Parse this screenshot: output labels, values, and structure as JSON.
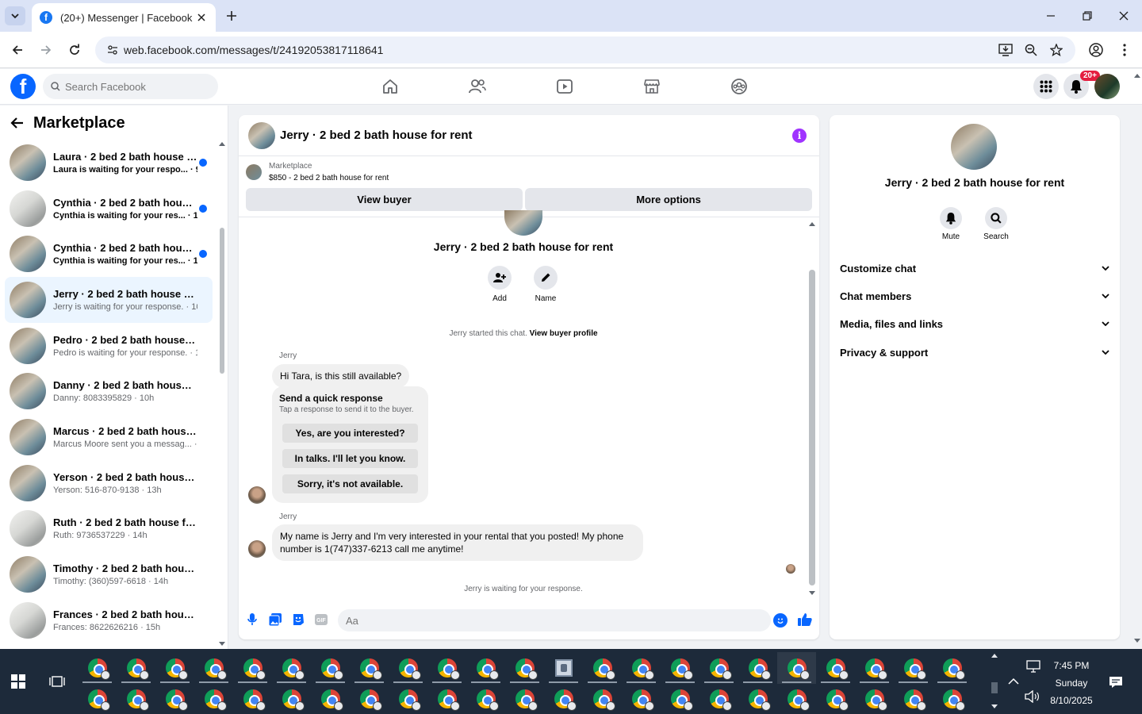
{
  "browser": {
    "tab_title": "(20+) Messenger | Facebook",
    "url": "web.facebook.com/messages/t/24192053817118641"
  },
  "fb": {
    "search_placeholder": "Search Facebook",
    "notification_badge": "20+"
  },
  "sidebar": {
    "title": "Marketplace",
    "conversations": [
      {
        "name": "Laura · 2 bed 2 bath house for...",
        "preview": "Laura is waiting for your respo... · 9h",
        "unread": true,
        "avatar": "room"
      },
      {
        "name": "Cynthia · 2 bed 2 bath house f...",
        "preview": "Cynthia is waiting for your res... · 10h",
        "unread": true,
        "avatar": "white"
      },
      {
        "name": "Cynthia · 2 bed 2 bath house f...",
        "preview": "Cynthia is waiting for your res... · 10h",
        "unread": true,
        "avatar": "room"
      },
      {
        "name": "Jerry · 2 bed 2 bath house for r...",
        "preview": "Jerry is waiting for your response. · 10h",
        "unread": false,
        "active": true,
        "avatar": "room"
      },
      {
        "name": "Pedro · 2 bed 2 bath house for r...",
        "preview": "Pedro is waiting for your response. · 10h",
        "unread": false,
        "avatar": "room"
      },
      {
        "name": "Danny · 2 bed 2 bath house for ...",
        "preview": "Danny: 8083395829 · 10h",
        "unread": false,
        "avatar": "room"
      },
      {
        "name": "Marcus · 2 bed 2 bath house for...",
        "preview": "Marcus Moore sent you a messag... · 11h",
        "unread": false,
        "avatar": "room"
      },
      {
        "name": "Yerson · 2 bed 2 bath house for ...",
        "preview": "Yerson: 516-870-9138 · 13h",
        "unread": false,
        "avatar": "room"
      },
      {
        "name": "Ruth · 2 bed 2 bath house for re...",
        "preview": "Ruth: 9736537229 · 14h",
        "unread": false,
        "avatar": "white"
      },
      {
        "name": "Timothy · 2 bed 2 bath house f...",
        "preview": "Timothy: (360)597-6618 · 14h",
        "unread": false,
        "avatar": "room"
      },
      {
        "name": "Frances · 2 bed 2 bath house fo...",
        "preview": "Frances: 8622626216 · 15h",
        "unread": false,
        "avatar": "white"
      }
    ]
  },
  "chat": {
    "title": "Jerry · 2 bed 2 bath house for rent",
    "marketplace_label": "Marketplace",
    "listing": "$850 - 2 bed 2 bath house for rent",
    "view_buyer": "View buyer",
    "more_options": "More options",
    "big_name": "Jerry · 2 bed 2 bath house for rent",
    "add_label": "Add",
    "name_label": "Name",
    "started_text": "Jerry started this chat.",
    "view_buyer_profile": "View buyer profile",
    "sender": "Jerry",
    "msg1": "Hi Tara, is this still available?",
    "quick_title": "Send a quick response",
    "quick_sub": "Tap a response to send it to the buyer.",
    "quick_replies": [
      "Yes, are you interested?",
      "In talks. I'll let you know.",
      "Sorry, it's not available."
    ],
    "msg2": "My name is Jerry and I'm very interested in your rental that you posted! My phone number is 1(747)337-6213 call me anytime!",
    "waiting": "Jerry is waiting for your response.",
    "composer_placeholder": "Aa"
  },
  "details": {
    "name": "Jerry · 2 bed 2 bath house for rent",
    "mute": "Mute",
    "search": "Search",
    "sections": [
      "Customize chat",
      "Chat members",
      "Media, files and links",
      "Privacy & support"
    ]
  },
  "taskbar": {
    "time": "7:45 PM",
    "day": "Sunday",
    "date": "8/10/2025"
  },
  "colors": {
    "fb_blue": "#0866ff",
    "active_row": "#ebf5ff",
    "info_purple": "#a033ff",
    "badge_red": "#e41e3f"
  }
}
